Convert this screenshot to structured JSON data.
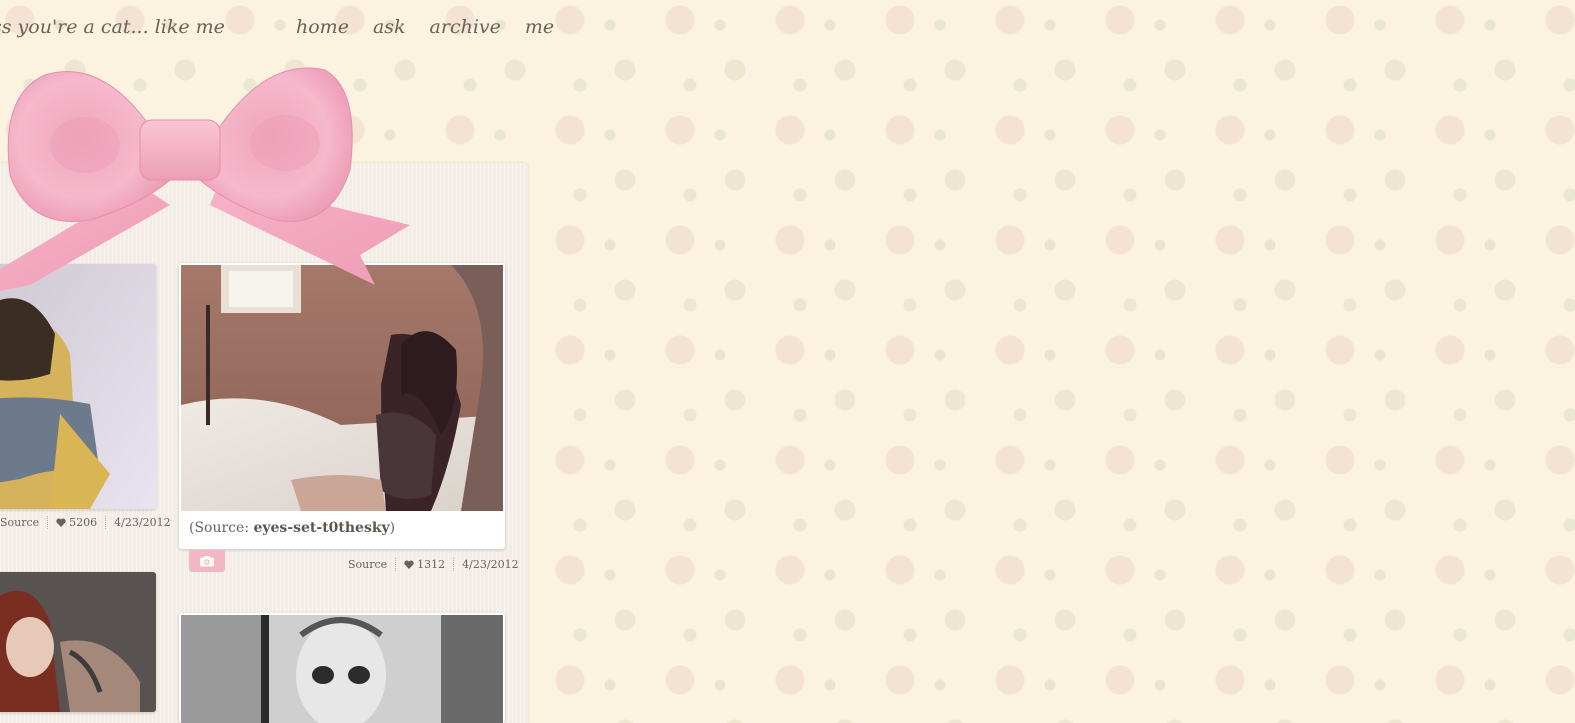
{
  "blog": {
    "title": "ss you're a cat... like me"
  },
  "nav": {
    "items": [
      "home",
      "ask",
      "archive",
      "me"
    ]
  },
  "posts": {
    "left_top": {
      "source_label": "Source",
      "likes": "5206",
      "date": "4/23/2012"
    },
    "right_top": {
      "caption_prefix": "(Source: ",
      "caption_source": "eyes-set-t0thesky",
      "caption_suffix": ")",
      "source_label": "Source",
      "likes": "1312",
      "date": "4/23/2012"
    }
  },
  "colors": {
    "bow": "#f5a9c1",
    "camera_tag": "#f2b7c3",
    "background": "#fbf3e0"
  },
  "icons": {
    "heart": "heart-icon",
    "camera": "camera-icon"
  }
}
